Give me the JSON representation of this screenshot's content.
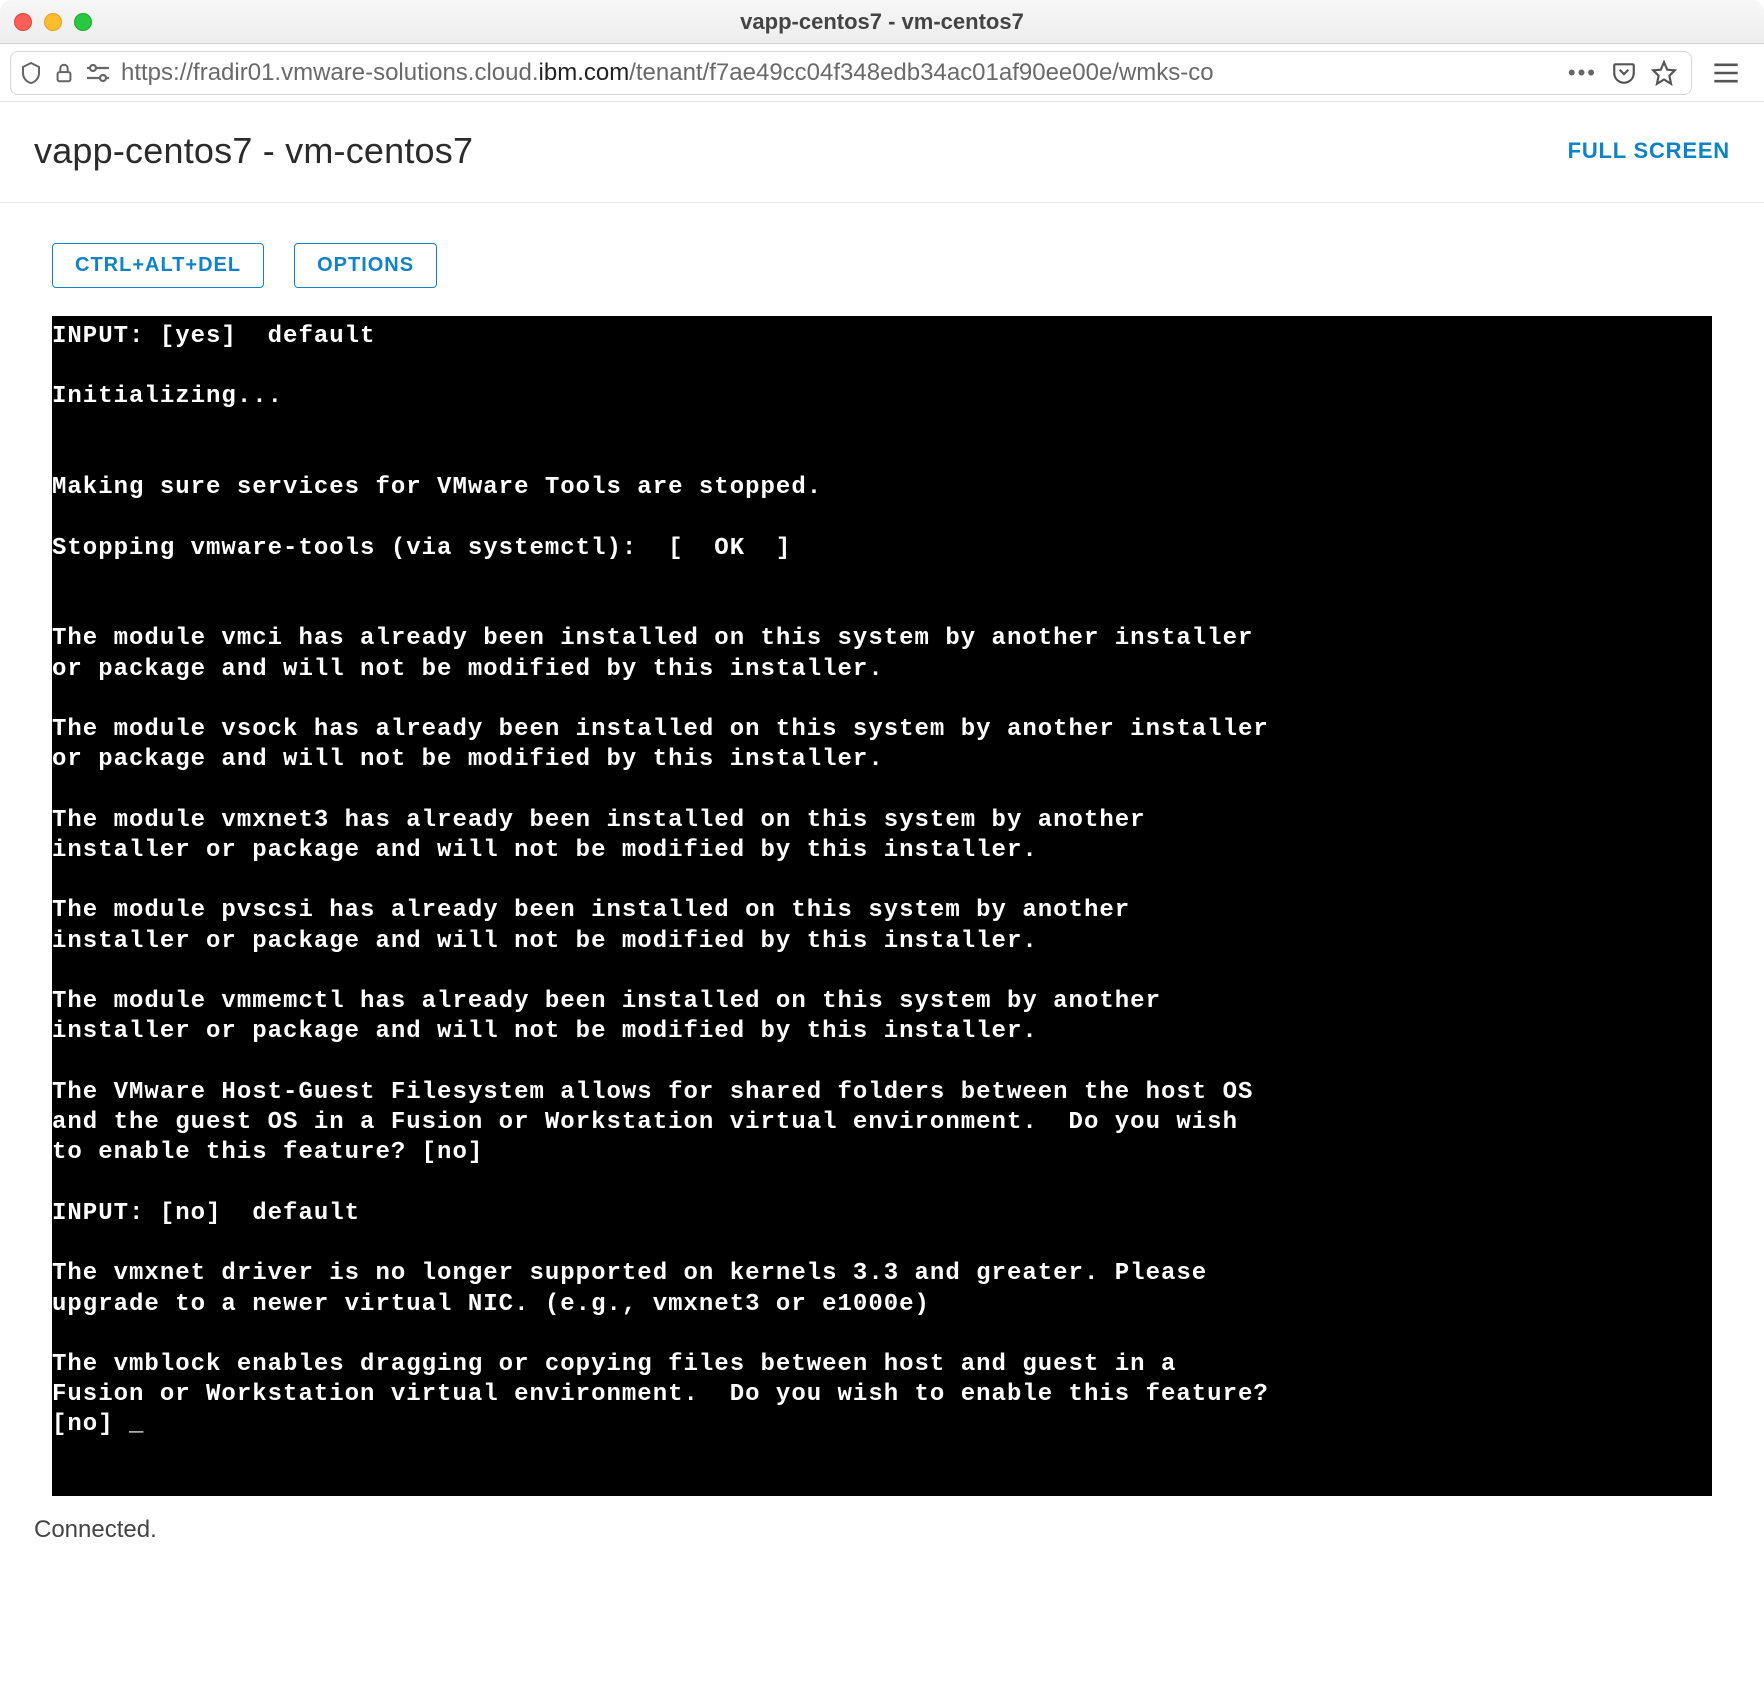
{
  "browser": {
    "window_title": "vapp-centos7 - vm-centos7",
    "url_prefix": "https://fradir01.vmware-solutions.cloud.",
    "url_domain": "ibm.com",
    "url_suffix": "/tenant/f7ae49cc04f348edb34ac01af90ee00e/wmks-co",
    "ellipsis": "•••"
  },
  "page": {
    "title": "vapp-centos7 - vm-centos7",
    "full_screen_label": "FULL SCREEN",
    "buttons": {
      "ctrl_alt_del": "CTRL+ALT+DEL",
      "options": "OPTIONS"
    },
    "status": "Connected."
  },
  "console_lines": [
    "INPUT: [yes]  default",
    "",
    "Initializing...",
    "",
    "",
    "Making sure services for VMware Tools are stopped.",
    "",
    "Stopping vmware-tools (via systemctl):  [  OK  ]",
    "",
    "",
    "The module vmci has already been installed on this system by another installer",
    "or package and will not be modified by this installer.",
    "",
    "The module vsock has already been installed on this system by another installer",
    "or package and will not be modified by this installer.",
    "",
    "The module vmxnet3 has already been installed on this system by another",
    "installer or package and will not be modified by this installer.",
    "",
    "The module pvscsi has already been installed on this system by another",
    "installer or package and will not be modified by this installer.",
    "",
    "The module vmmemctl has already been installed on this system by another",
    "installer or package and will not be modified by this installer.",
    "",
    "The VMware Host-Guest Filesystem allows for shared folders between the host OS",
    "and the guest OS in a Fusion or Workstation virtual environment.  Do you wish",
    "to enable this feature? [no]",
    "",
    "INPUT: [no]  default",
    "",
    "The vmxnet driver is no longer supported on kernels 3.3 and greater. Please",
    "upgrade to a newer virtual NIC. (e.g., vmxnet3 or e1000e)",
    "",
    "The vmblock enables dragging or copying files between host and guest in a",
    "Fusion or Workstation virtual environment.  Do you wish to enable this feature?",
    "[no] _"
  ]
}
